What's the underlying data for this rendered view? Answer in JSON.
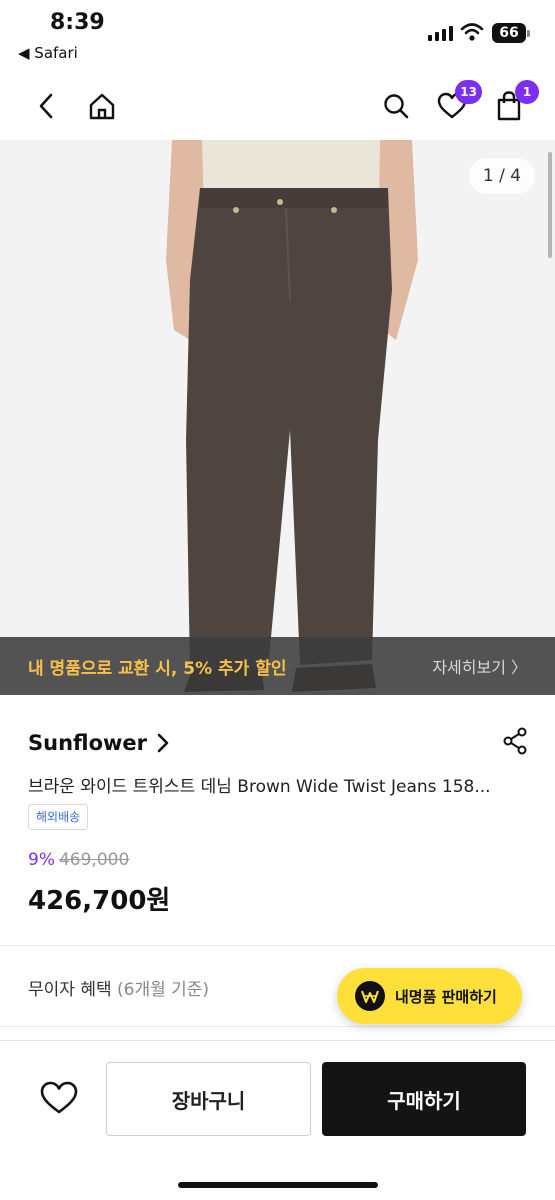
{
  "status_bar": {
    "time": "8:39",
    "back_app": "◀ Safari",
    "battery": "66"
  },
  "nav": {
    "cart_badge": "1",
    "wishlist_badge": "13"
  },
  "gallery": {
    "counter": "1 / 4"
  },
  "promo": {
    "text": "내 명품으로 교환 시, 5% 추가 할인",
    "more": "자세히보기 〉"
  },
  "product": {
    "brand": "Sunflower",
    "title": "브라운 와이드 트위스트 데님 Brown Wide Twist Jeans 158...",
    "tag": "해외배송",
    "discount": "9%",
    "original_price": "469,000",
    "price": "426,700원"
  },
  "benefit": {
    "label": "무이자 혜택",
    "sub": "(6개월 기준)"
  },
  "fab": {
    "label": "내명품 판매하기"
  },
  "actions": {
    "cart": "장바구니",
    "buy": "구매하기"
  },
  "colors": {
    "accent": "#7b2ff2",
    "promo_text": "#f8c24a",
    "fab": "#ffe03a",
    "buy": "#141414"
  }
}
